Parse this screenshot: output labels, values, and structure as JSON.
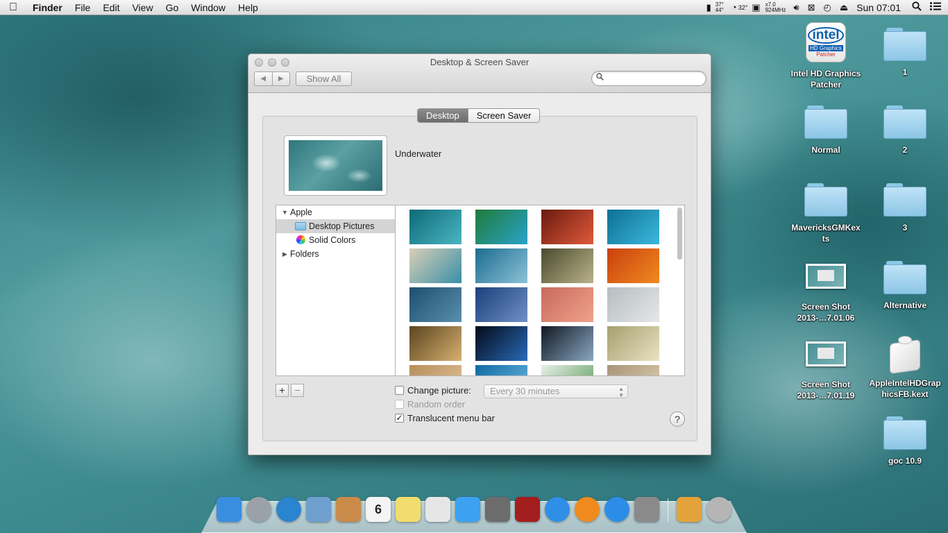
{
  "menubar": {
    "apple_icon": "apple-logo-icon",
    "items": [
      "Finder",
      "File",
      "Edit",
      "View",
      "Go",
      "Window",
      "Help"
    ],
    "status": {
      "temp1_top": "37°",
      "temp1_bottom": "44°",
      "temp2": "32°",
      "cpu_mult": "x7.0",
      "cpu_freq": "924MHz",
      "clock": "Sun 07:01"
    }
  },
  "desktop_icons": [
    {
      "label": "Intel HD Graphics Patcher",
      "kind": "app"
    },
    {
      "label": "1",
      "kind": "folder"
    },
    {
      "label": "Normal",
      "kind": "folder"
    },
    {
      "label": "2",
      "kind": "folder"
    },
    {
      "label": "MavericksGMKexts",
      "kind": "folder"
    },
    {
      "label": "3",
      "kind": "folder"
    },
    {
      "label": "Screen Shot 2013-…7.01.06",
      "kind": "screenshot"
    },
    {
      "label": "Alternative",
      "kind": "folder"
    },
    {
      "label": "Screen Shot 2013-…7.01.19",
      "kind": "screenshot"
    },
    {
      "label": "AppleIntelHDGraphicsFB.kext",
      "kind": "kext"
    },
    {
      "label": "goc 10.9",
      "kind": "folder"
    }
  ],
  "intel_icon": {
    "logo": "intel",
    "line1": "HD Graphics",
    "line2": "Patcher"
  },
  "window": {
    "title": "Desktop & Screen Saver",
    "back_label": "◀",
    "forward_label": "▶",
    "show_all": "Show All",
    "search": {
      "value": "",
      "placeholder": ""
    },
    "tabs": [
      {
        "label": "Desktop",
        "active": true
      },
      {
        "label": "Screen Saver",
        "active": false
      }
    ],
    "current_picture": "Underwater",
    "sources": {
      "apple": "Apple",
      "desktop_pictures": "Desktop Pictures",
      "solid_colors": "Solid Colors",
      "folders": "Folders"
    },
    "thumbnails": [
      {
        "name": "wave-blue",
        "colors": [
          "#0d6a78",
          "#4bb5c2"
        ]
      },
      {
        "name": "aerial-green",
        "colors": [
          "#1f7b3a",
          "#2aa3c9"
        ]
      },
      {
        "name": "antelope-canyon",
        "colors": [
          "#6a1a10",
          "#e05a3a"
        ]
      },
      {
        "name": "water-ripples",
        "colors": [
          "#0e6f93",
          "#3bb8dd"
        ]
      },
      {
        "name": "beach-shore",
        "colors": [
          "#d8cfb6",
          "#3a8fa8"
        ]
      },
      {
        "name": "frozen-trees",
        "colors": [
          "#1a6c8f",
          "#8ec2d7"
        ]
      },
      {
        "name": "grass-field",
        "colors": [
          "#4b4a2e",
          "#b9b38a"
        ]
      },
      {
        "name": "autumn-leaves",
        "colors": [
          "#c9400d",
          "#f08a20"
        ]
      },
      {
        "name": "blue-pattern",
        "colors": [
          "#1e4e6d",
          "#5a8fae"
        ]
      },
      {
        "name": "blue-mesh",
        "colors": [
          "#1c3f7a",
          "#6f90c7"
        ]
      },
      {
        "name": "pink-dunes",
        "colors": [
          "#c76a5c",
          "#f0a28c"
        ]
      },
      {
        "name": "foggy-lake",
        "colors": [
          "#b7bdc0",
          "#e4e7e8"
        ]
      },
      {
        "name": "golden-blur",
        "colors": [
          "#5a4420",
          "#d7b070"
        ]
      },
      {
        "name": "earth-horizon",
        "colors": [
          "#020a18",
          "#2a6ab8"
        ]
      },
      {
        "name": "earth-orbit",
        "colors": [
          "#101822",
          "#8aa7c2"
        ]
      },
      {
        "name": "elephant-savanna",
        "colors": [
          "#a5a070",
          "#e8e2c2"
        ]
      },
      {
        "name": "sand-bottom",
        "colors": [
          "#b68d5a",
          "#e3c59a"
        ]
      },
      {
        "name": "ocean-bottom",
        "colors": [
          "#0f6aa3",
          "#70b8e0"
        ]
      },
      {
        "name": "leaves-white",
        "colors": [
          "#e6f0e6",
          "#5b9a5a"
        ]
      },
      {
        "name": "stones-row",
        "colors": [
          "#a89478",
          "#e0d0b0"
        ]
      }
    ],
    "add_label": "+",
    "remove_label": "−",
    "change_picture": {
      "label": "Change picture:",
      "checked": false,
      "interval": "Every 30 minutes"
    },
    "random_order": {
      "label": "Random order",
      "checked": false,
      "enabled": false
    },
    "translucent": {
      "label": "Translucent menu bar",
      "checked": true,
      "mark": "✓"
    },
    "help_label": "?"
  },
  "dock": {
    "items": [
      {
        "name": "Finder",
        "color": "#3a8ee0"
      },
      {
        "name": "Launchpad",
        "color": "#9aa2a8"
      },
      {
        "name": "Safari",
        "color": "#2a84d0"
      },
      {
        "name": "Mail",
        "color": "#6f9fcf"
      },
      {
        "name": "Contacts",
        "color": "#c98a4a"
      },
      {
        "name": "Calendar",
        "color": "#f4f4f4",
        "text": "6"
      },
      {
        "name": "Notes",
        "color": "#f1dd6e"
      },
      {
        "name": "Reminders",
        "color": "#e6e6e6"
      },
      {
        "name": "Messages",
        "color": "#3ba1f0"
      },
      {
        "name": "FaceTime",
        "color": "#6c6c6c"
      },
      {
        "name": "Photo Booth",
        "color": "#a31e1e"
      },
      {
        "name": "iTunes",
        "color": "#2f8fe6"
      },
      {
        "name": "iBooks",
        "color": "#f08a1c"
      },
      {
        "name": "App Store",
        "color": "#2c8de8"
      },
      {
        "name": "System Preferences",
        "color": "#8a8a8a"
      },
      {
        "name": "Applications",
        "color": "#e3a33a"
      },
      {
        "name": "Trash",
        "color": "#b5b5b5"
      }
    ]
  }
}
